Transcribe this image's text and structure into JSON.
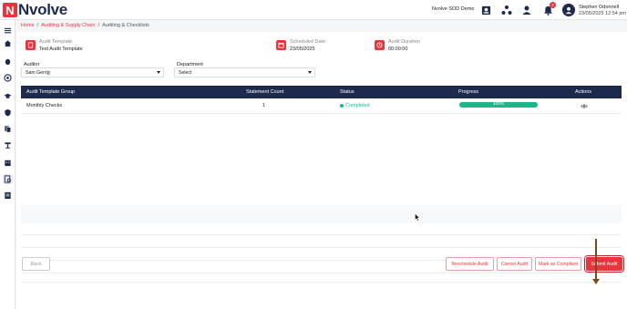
{
  "app": {
    "logo_letter": "N",
    "logo_text": "Nvolve"
  },
  "header": {
    "org_name": "Nvolve SOD Demo",
    "notification_count": "2",
    "user_name": "Stephen Odonnell",
    "user_datetime": "23/05/2025 12:54 pm"
  },
  "breadcrumb": {
    "home": "Home",
    "sep": "/",
    "section": "Auditing & Supply Chain",
    "current": "Auditing & Checklists"
  },
  "audit": {
    "template_label": "Audit Template",
    "template_value": "Test Audit Template",
    "scheduled_label": "Scheduled Date",
    "scheduled_value": "23/05/2025",
    "duration_label": "Audit Duration",
    "duration_value": "00:00:00"
  },
  "form": {
    "auditor_label": "Auditor",
    "auditor_value": "Sam Gerrijy",
    "department_label": "Department",
    "department_value": "Select"
  },
  "table": {
    "headers": [
      "Audit Template Group",
      "Statement Count",
      "Status",
      "Progress",
      "Actions"
    ],
    "rows": [
      {
        "group": "Monthly Checks",
        "count": "1",
        "status": "Completed",
        "progress": "100%",
        "progress_value": 100
      }
    ]
  },
  "buttons": {
    "back": "Back",
    "reschedule": "Reschedule Audit",
    "cancel": "Cancel Audit",
    "mark_compliant": "Mark as Compliant",
    "submit": "Submit Audit"
  },
  "colors": {
    "brand_red": "#e8343a",
    "navy": "#1d2a4e",
    "success": "#1eb58a"
  },
  "icons": [
    "menu-icon",
    "home-icon",
    "bug-icon",
    "money-icon",
    "graduation-icon",
    "shield-icon",
    "clipboard-icon",
    "trophy-icon",
    "building-icon",
    "audit-icon",
    "report-icon"
  ]
}
